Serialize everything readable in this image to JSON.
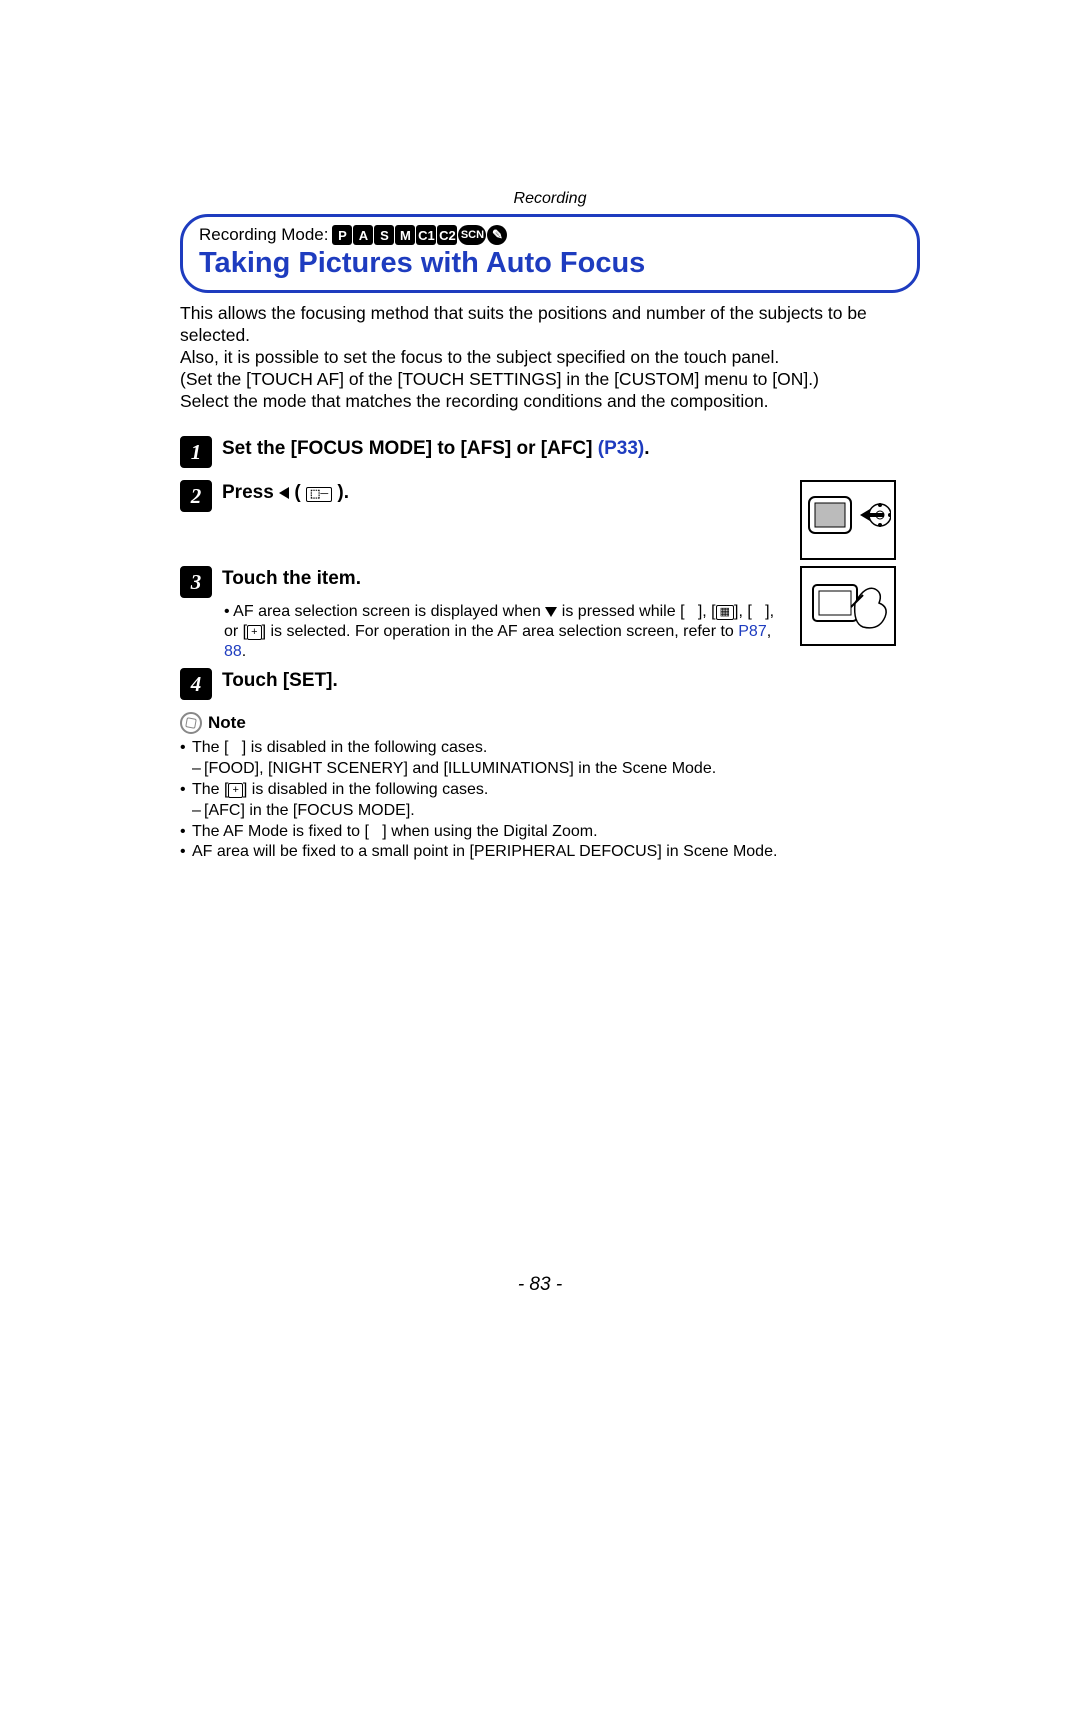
{
  "header": {
    "section": "Recording"
  },
  "title_box": {
    "recording_mode_label": "Recording Mode:",
    "modes": [
      "P",
      "A",
      "S",
      "M",
      "C1",
      "C2",
      "SCN",
      "✎"
    ],
    "title": "Taking Pictures with Auto Focus"
  },
  "intro": {
    "p1": "This allows the focusing method that suits the positions and number of the subjects to be selected.",
    "p2": "Also, it is possible to set the focus to the subject specified on the touch panel.",
    "p3": "(Set the [TOUCH AF] of the [TOUCH SETTINGS] in the [CUSTOM] menu to [ON].)",
    "p4": "Select the mode that matches the recording conditions and the composition."
  },
  "steps": {
    "s1": {
      "num": "1",
      "label_a": "Set the [FOCUS MODE] to [AFS] or [AFC]",
      "link": "(P33)",
      "label_b": "."
    },
    "s2": {
      "num": "2",
      "label_a": "Press ",
      "label_b": " ( ",
      "label_c": " )."
    },
    "s3": {
      "num": "3",
      "label": "Touch the item.",
      "detail_a": "AF area selection screen is displayed when ",
      "detail_b": " is pressed while [   ], [",
      "detail_c": "], [   ], or [",
      "detail_d": "] is selected. For operation in the AF area selection screen, refer to ",
      "link1": "P87",
      "link2": "88",
      "detail_e": "."
    },
    "s4": {
      "num": "4",
      "label": "Touch [SET]."
    }
  },
  "note": {
    "heading": "Note",
    "n1a": "The [   ] is disabled in the following cases.",
    "n1b": "[FOOD], [NIGHT SCENERY] and [ILLUMINATIONS] in the Scene Mode.",
    "n2a_pre": "The [",
    "n2a_post": "] is disabled in the following cases.",
    "n2b": "[AFC] in the [FOCUS MODE].",
    "n3": "The AF Mode is fixed to [   ] when using the Digital Zoom.",
    "n4": "AF area will be fixed to a small point in [PERIPHERAL DEFOCUS] in Scene Mode."
  },
  "page_number": "- 83 -"
}
